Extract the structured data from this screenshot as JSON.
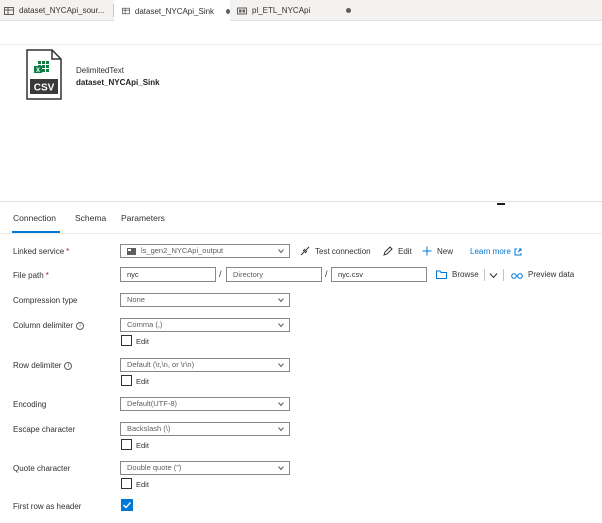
{
  "tabs": [
    {
      "label": "dataset_NYCApi_sour...",
      "icon": "table-icon",
      "active": false
    },
    {
      "label": "dataset_NYCApi_Sink",
      "icon": "table-icon",
      "active": true
    },
    {
      "label": "pl_ETL_NYCApi",
      "icon": "pipeline-icon",
      "active": false
    }
  ],
  "dataset": {
    "icon_text": "CSV",
    "type": "DelimitedText",
    "name": "dataset_NYCApi_Sink"
  },
  "config_tabs": [
    "Connection",
    "Schema",
    "Parameters"
  ],
  "form": {
    "linked_service": {
      "label": "Linked service",
      "required": "*",
      "value": "ls_gen2_NYCApi_output",
      "test_connection": "Test connection",
      "edit": "Edit",
      "new": "New",
      "learn_more": "Learn more"
    },
    "file_path": {
      "label": "File path",
      "required": "*",
      "container": "nyc",
      "directory_placeholder": "Directory",
      "file": "nyc.csv",
      "separator": "/",
      "browse": "Browse",
      "preview": "Preview data"
    },
    "compression_type": {
      "label": "Compression type",
      "value": "None"
    },
    "column_delimiter": {
      "label": "Column delimiter",
      "value": "Comma (,)",
      "edit": "Edit"
    },
    "row_delimiter": {
      "label": "Row delimiter",
      "value": "Default (\\r,\\n, or \\r\\n)",
      "edit": "Edit"
    },
    "encoding": {
      "label": "Encoding",
      "value": "Default(UTF-8)"
    },
    "escape_character": {
      "label": "Escape character",
      "value": "Backslash (\\)",
      "edit": "Edit"
    },
    "quote_character": {
      "label": "Quote character",
      "value": "Double quote (\")",
      "edit": "Edit"
    },
    "first_row_header": {
      "label": "First row as header",
      "checked": true
    }
  },
  "colors": {
    "accent": "#0078d4",
    "csv_green": "#107c41"
  }
}
